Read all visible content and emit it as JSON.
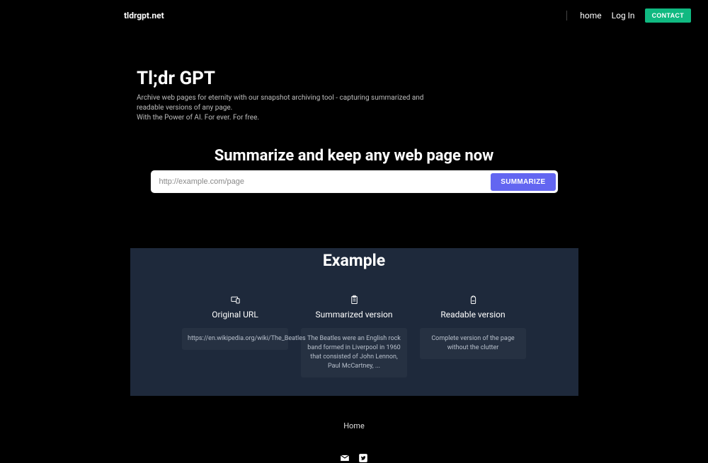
{
  "header": {
    "logo": "tldrgpt.net",
    "nav": {
      "home": "home",
      "login": "Log In",
      "contact": "CONTACT"
    }
  },
  "hero": {
    "title": "Tl;dr GPT",
    "subtitle_line1": "Archive web pages for eternity with our snapshot archiving tool - capturing summarized and readable versions of any page.",
    "subtitle_line2": "With the Power of AI. For ever. For free."
  },
  "summarize": {
    "heading": "Summarize and keep any web page now",
    "placeholder": "http://example.com/page",
    "button": "SUMMARIZE"
  },
  "example": {
    "title": "Example",
    "cols": [
      {
        "head": "Original URL",
        "body": "https://en.wikipedia.org/wiki/The_Beatles"
      },
      {
        "head": "Summarized version",
        "body": "The Beatles were an English rock band formed in Liverpool in 1960 that consisted of John Lennon, Paul McCartney, ..."
      },
      {
        "head": "Readable version",
        "body": "Complete version of the page without the clutter"
      }
    ]
  },
  "footer": {
    "home": "Home"
  }
}
